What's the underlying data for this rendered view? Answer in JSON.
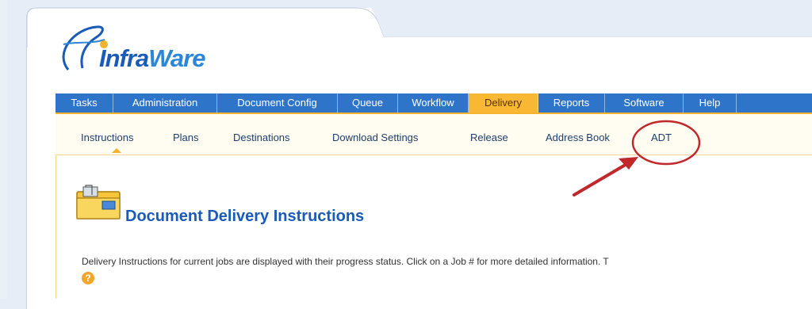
{
  "logo": {
    "part1": "Infra",
    "part2": "Ware"
  },
  "nav": {
    "items": [
      {
        "label": "Tasks"
      },
      {
        "label": "Administration"
      },
      {
        "label": "Document Config"
      },
      {
        "label": "Queue"
      },
      {
        "label": "Workflow"
      },
      {
        "label": "Delivery",
        "active": true
      },
      {
        "label": "Reports"
      },
      {
        "label": "Software"
      },
      {
        "label": "Help"
      }
    ]
  },
  "subnav": {
    "items": [
      {
        "label": "Instructions",
        "active": true
      },
      {
        "label": "Plans"
      },
      {
        "label": "Destinations"
      },
      {
        "label": "Download Settings"
      },
      {
        "label": "Release"
      },
      {
        "label": "Address Book"
      },
      {
        "label": "ADT",
        "highlighted": true
      }
    ]
  },
  "main": {
    "title": "Document Delivery Instructions",
    "description": "Delivery Instructions for current jobs are displayed with their progress status. Click on a Job # for more detailed information. T",
    "help_icon_glyph": "?"
  },
  "colors": {
    "nav_bg": "#2e74c9",
    "nav_active": "#f8b833",
    "accent": "#f5b22c",
    "title": "#1a5bb8",
    "annotation": "#c0282b"
  },
  "icons": [
    "folder-icon",
    "help-icon",
    "logo-swoosh-icon"
  ]
}
